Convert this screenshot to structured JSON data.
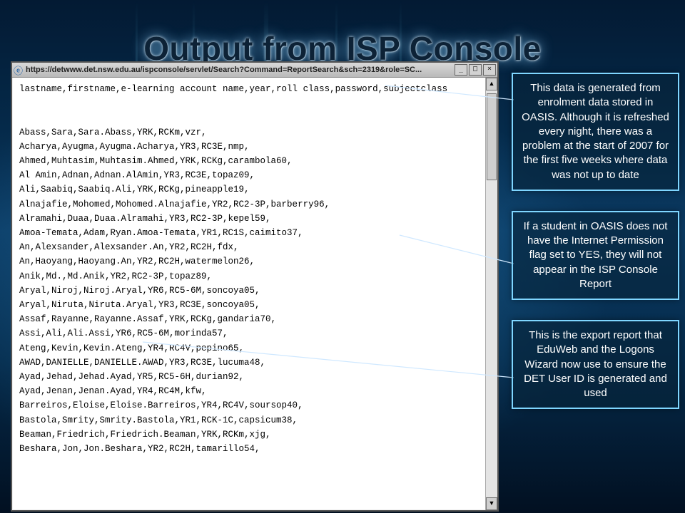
{
  "title": "Output from ISP Console",
  "window": {
    "address": "https://detwww.det.nsw.edu.au/ispconsole/servlet/Search?Command=ReportSearch&sch=2319&role=SC...",
    "btn_min": "_",
    "btn_max": "□",
    "btn_close": "×"
  },
  "report": {
    "header": "lastname,firstname,e-learning account name,year,roll class,password,subjectclass",
    "rows": [
      "Abass,Sara,Sara.Abass,YRK,RCKm,vzr,",
      "Acharya,Ayugma,Ayugma.Acharya,YR3,RC3E,nmp,",
      "Ahmed,Muhtasim,Muhtasim.Ahmed,YRK,RCKg,carambola60,",
      "Al Amin,Adnan,Adnan.AlAmin,YR3,RC3E,topaz09,",
      "Ali,Saabiq,Saabiq.Ali,YRK,RCKg,pineapple19,",
      "Alnajafie,Mohomed,Mohomed.Alnajafie,YR2,RC2-3P,barberry96,",
      "Alramahi,Duaa,Duaa.Alramahi,YR3,RC2-3P,kepel59,",
      "Amoa-Temata,Adam,Ryan.Amoa-Temata,YR1,RC1S,caimito37,",
      "An,Alexsander,Alexsander.An,YR2,RC2H,fdx,",
      "An,Haoyang,Haoyang.An,YR2,RC2H,watermelon26,",
      "Anik,Md.,Md.Anik,YR2,RC2-3P,topaz89,",
      "Aryal,Niroj,Niroj.Aryal,YR6,RC5-6M,soncoya05,",
      "Aryal,Niruta,Niruta.Aryal,YR3,RC3E,soncoya05,",
      "Assaf,Rayanne,Rayanne.Assaf,YRK,RCKg,gandaria70,",
      "Assi,Ali,Ali.Assi,YR6,RC5-6M,morinda57,",
      "Ateng,Kevin,Kevin.Ateng,YR4,RC4V,pepino65,",
      "AWAD,DANIELLE,DANIELLE.AWAD,YR3,RC3E,lucuma48,",
      "Ayad,Jehad,Jehad.Ayad,YR5,RC5-6H,durian92,",
      "Ayad,Jenan,Jenan.Ayad,YR4,RC4M,kfw,",
      "Barreiros,Eloise,Eloise.Barreiros,YR4,RC4V,soursop40,",
      "Bastola,Smrity,Smrity.Bastola,YR1,RCK-1C,capsicum38,",
      "Beaman,Friedrich,Friedrich.Beaman,YRK,RCKm,xjg,",
      "Beshara,Jon,Jon.Beshara,YR2,RC2H,tamarillo54,"
    ]
  },
  "notes": {
    "n1": "This data is generated from enrolment data stored in OASIS. Although it is refreshed every night, there was a problem at the start of 2007 for the first five weeks where data was not up to date",
    "n2": "If a student in OASIS does not have the Internet Permission flag set to YES, they will not appear in the ISP Console Report",
    "n3": "This is the export report that EduWeb and the Logons Wizard now use to ensure the DET User ID is generated and used"
  }
}
